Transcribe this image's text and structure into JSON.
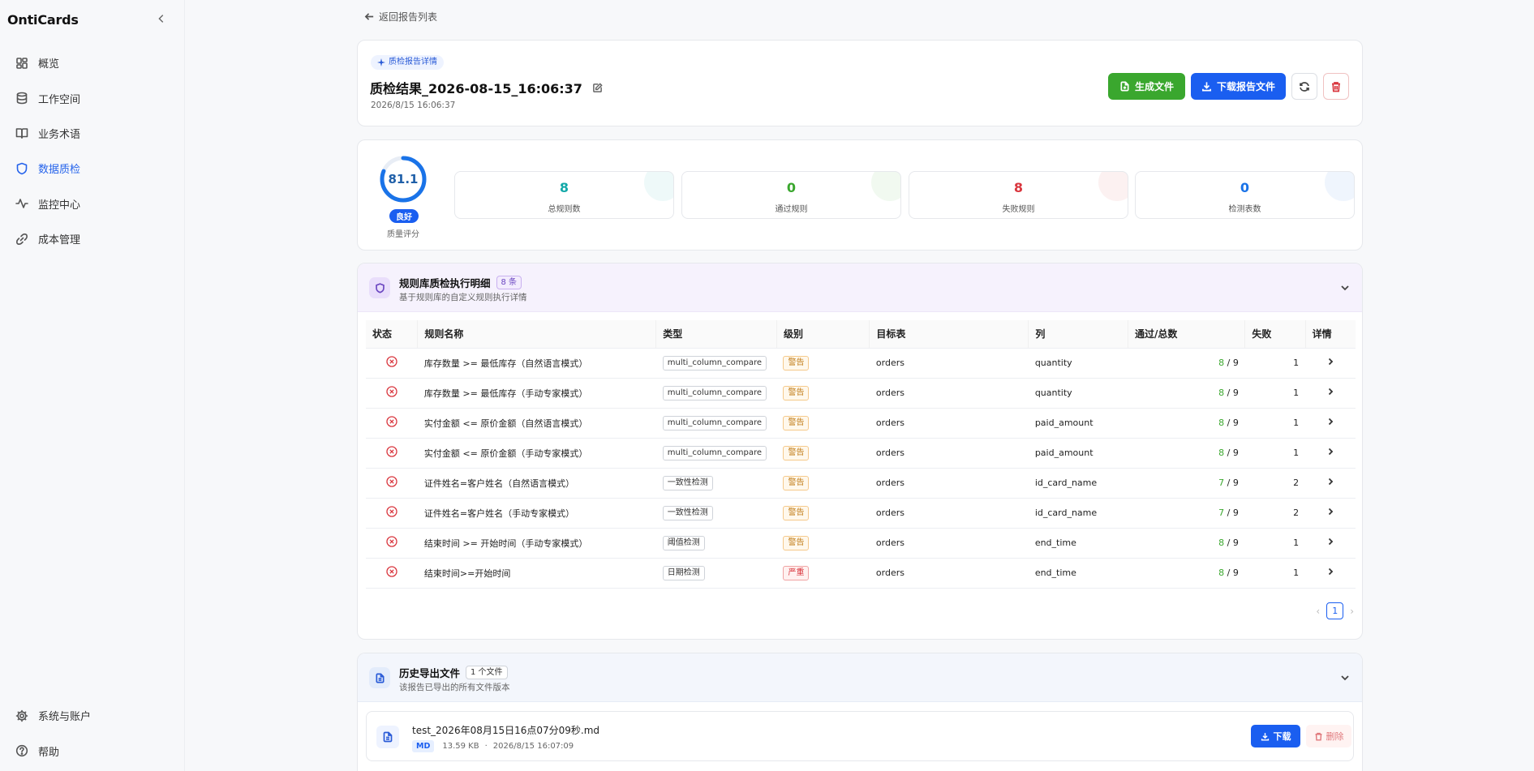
{
  "app": {
    "brand": "OntiCards"
  },
  "sidebar": {
    "items": [
      {
        "label": "概览",
        "icon": "dashboard-icon"
      },
      {
        "label": "工作空间",
        "icon": "database-icon"
      },
      {
        "label": "业务术语",
        "icon": "book-icon"
      },
      {
        "label": "数据质检",
        "icon": "shield-icon",
        "active": true
      },
      {
        "label": "监控中心",
        "icon": "activity-icon"
      },
      {
        "label": "成本管理",
        "icon": "link-icon"
      }
    ],
    "bottom": [
      {
        "label": "系统与账户",
        "icon": "gear-icon"
      },
      {
        "label": "帮助",
        "icon": "help-icon"
      }
    ]
  },
  "back": {
    "label": "返回报告列表"
  },
  "header": {
    "tag": "质检报告详情",
    "title": "质检结果_2026-08-15_16:06:37",
    "time": "2026/8/15 16:06:37",
    "generate_label": "生成文件",
    "download_label": "下载报告文件"
  },
  "score": {
    "value": "81.1",
    "percent": 81.1,
    "grade": "良好",
    "label": "质量评分",
    "color": "#1a73e8"
  },
  "stats": [
    {
      "value": "8",
      "label": "总规则数",
      "color": "#13a8a8"
    },
    {
      "value": "0",
      "label": "通过规则",
      "color": "#3aa72e"
    },
    {
      "value": "8",
      "label": "失败规则",
      "color": "#d9363e"
    },
    {
      "value": "0",
      "label": "检测表数",
      "color": "#1a73e8"
    }
  ],
  "rules": {
    "title": "规则库质检执行明细",
    "count": "8 条",
    "subtitle": "基于规则库的自定义规则执行详情",
    "columns": [
      "状态",
      "规则名称",
      "类型",
      "级别",
      "目标表",
      "列",
      "通过/总数",
      "失败",
      "详情"
    ],
    "rows": [
      {
        "name": "库存数量 >= 最低库存（自然语言模式）",
        "type": "multi_column_compare",
        "level": "警告",
        "table": "orders",
        "column": "quantity",
        "passed": "8",
        "total": "/ 9",
        "failed": "1"
      },
      {
        "name": "库存数量 >= 最低库存（手动专家模式）",
        "type": "multi_column_compare",
        "level": "警告",
        "table": "orders",
        "column": "quantity",
        "passed": "8",
        "total": "/ 9",
        "failed": "1"
      },
      {
        "name": "实付金额 <= 原价金额（自然语言模式）",
        "type": "multi_column_compare",
        "level": "警告",
        "table": "orders",
        "column": "paid_amount",
        "passed": "8",
        "total": "/ 9",
        "failed": "1"
      },
      {
        "name": "实付金额 <= 原价金额（手动专家模式）",
        "type": "multi_column_compare",
        "level": "警告",
        "table": "orders",
        "column": "paid_amount",
        "passed": "8",
        "total": "/ 9",
        "failed": "1"
      },
      {
        "name": "证件姓名=客户姓名（自然语言模式）",
        "type": "一致性检测",
        "level": "警告",
        "table": "orders",
        "column": "id_card_name",
        "passed": "7",
        "total": "/ 9",
        "failed": "2"
      },
      {
        "name": "证件姓名=客户姓名（手动专家模式）",
        "type": "一致性检测",
        "level": "警告",
        "table": "orders",
        "column": "id_card_name",
        "passed": "7",
        "total": "/ 9",
        "failed": "2"
      },
      {
        "name": "结束时间 >= 开始时间（手动专家模式）",
        "type": "阈值检测",
        "level": "警告",
        "table": "orders",
        "column": "end_time",
        "passed": "8",
        "total": "/ 9",
        "failed": "1"
      },
      {
        "name": "结束时间>=开始时间",
        "type": "日期检测",
        "level": "严重",
        "table": "orders",
        "column": "end_time",
        "passed": "8",
        "total": "/ 9",
        "failed": "1"
      }
    ],
    "page": "1"
  },
  "files": {
    "title": "历史导出文件",
    "count": "1 个文件",
    "subtitle": "该报告已导出的所有文件版本",
    "items": [
      {
        "name": "test_2026年08月15日16点07分09秒.md",
        "format": "MD",
        "size": "13.59 KB",
        "time": "2026/8/15 16:07:09"
      }
    ],
    "download_label": "下载",
    "delete_label": "删除"
  }
}
